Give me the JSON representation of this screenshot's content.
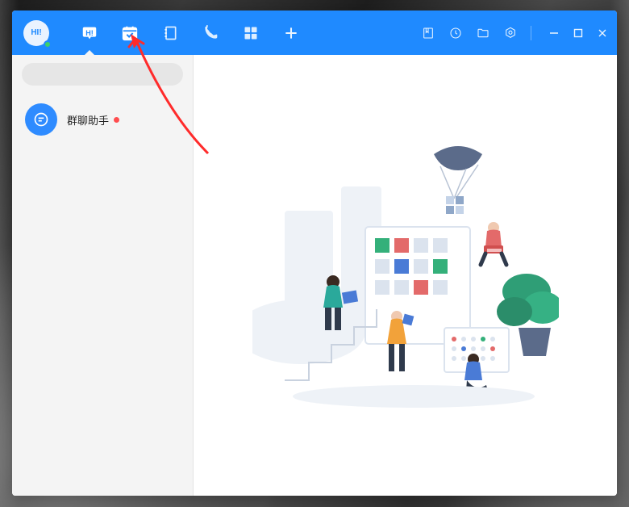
{
  "avatar": {
    "text": "HI!"
  },
  "status": "online",
  "tabs": {
    "chat": true,
    "calendar": true,
    "notes": true,
    "call": true,
    "apps": true,
    "add": true
  },
  "search": {
    "placeholder": ""
  },
  "chats": [
    {
      "title": "群聊助手",
      "unread": true
    }
  ],
  "accent": "#1f8aff"
}
